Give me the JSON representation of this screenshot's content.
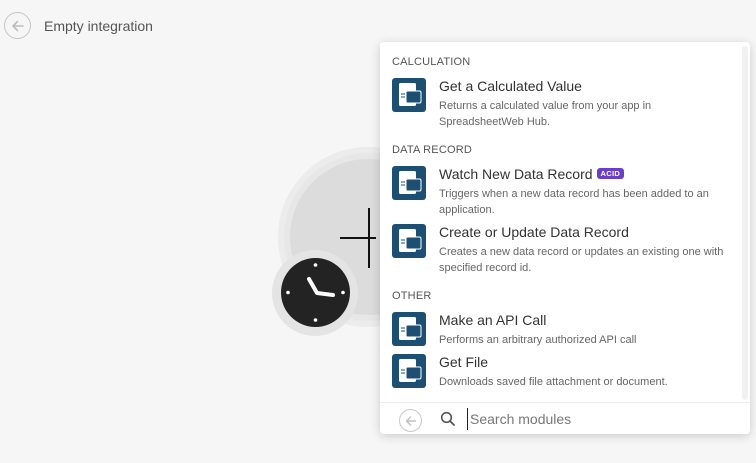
{
  "header": {
    "title": "Empty integration"
  },
  "panel": {
    "sections": [
      {
        "label": "CALCULATION",
        "items": [
          {
            "title": "Get a Calculated Value",
            "desc": "Returns a calculated value from your app in SpreadsheetWeb Hub.",
            "badge": ""
          }
        ]
      },
      {
        "label": "DATA RECORD",
        "items": [
          {
            "title": "Watch New Data Record",
            "desc": "Triggers when a new data record has been added to an application.",
            "badge": "ACID"
          },
          {
            "title": "Create or Update Data Record",
            "desc": "Creates a new data record or updates an existing one with specified record id.",
            "badge": ""
          }
        ]
      },
      {
        "label": "OTHER",
        "items": [
          {
            "title": "Make an API Call",
            "desc": "Performs an arbitrary authorized API call",
            "badge": ""
          },
          {
            "title": "Get File",
            "desc": "Downloads saved file attachment or document.",
            "badge": ""
          }
        ]
      }
    ],
    "app_icon_label": "SW",
    "search": {
      "placeholder": "Search modules",
      "value": ""
    }
  },
  "colors": {
    "app_icon": "#1d4f73",
    "badge": "#6a3fc7",
    "background": "#f6f6f6"
  },
  "icons": {
    "header_back": "arrow-left-circle-icon",
    "footer_back": "arrow-left-circle-icon",
    "search": "magnifier-icon",
    "trigger": "clock-icon",
    "add": "plus-icon"
  }
}
